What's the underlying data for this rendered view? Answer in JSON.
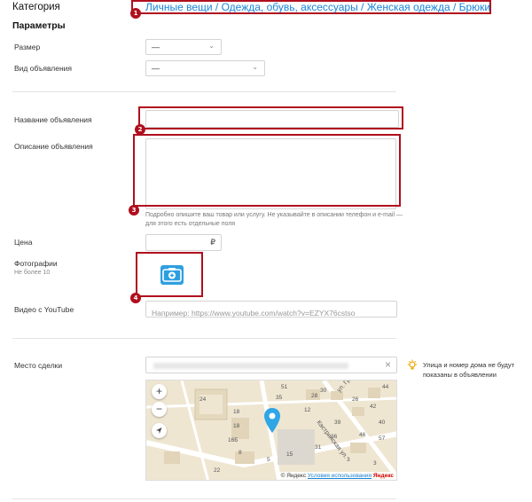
{
  "category": {
    "label": "Категория",
    "breadcrumb": "Личные вещи / Одежда, обувь, аксессуары / Женская одежда / Брюки"
  },
  "params": {
    "heading": "Параметры",
    "size_label": "Размер",
    "size_value": "—",
    "adtype_label": "Вид объявления",
    "adtype_value": "—"
  },
  "form": {
    "title_label": "Название объявления",
    "title_value": "",
    "description_label": "Описание объявления",
    "description_hint": "Подробно опишите ваш товар или услугу. Не указывайте в описании телефон и e-mail — для этого есть отдельные поля",
    "price_label": "Цена",
    "price_currency": "₽",
    "photos_label": "Фотографии",
    "photos_sub": "Не более 10",
    "youtube_label": "Видео с YouTube",
    "youtube_placeholder": "Например: https://www.youtube.com/watch?v=EZYX76cstso"
  },
  "location": {
    "label": "Место сделки",
    "clear_icon": "×",
    "tip": "Улица и номер дома не будут показаны в объявлении"
  },
  "map": {
    "zoom_in": "+",
    "zoom_out": "−",
    "house_numbers": [
      "24",
      "18",
      "18",
      "16Б",
      "51",
      "35",
      "30",
      "28",
      "26",
      "44",
      "42",
      "40",
      "12",
      "39",
      "46",
      "36",
      "31",
      "57",
      "15",
      "5",
      "3",
      "3",
      "8",
      "22"
    ],
    "street_1": "ул. Григорьева",
    "street_2": "Кастринская ул.",
    "copyright": "© Яндекс",
    "terms": "Условия использования",
    "brand": "Яндекс"
  },
  "annotations": [
    "1",
    "2",
    "3",
    "4"
  ],
  "colors": {
    "accent": "#1a84d8",
    "annotation": "#b00f1e",
    "photo_button": "#2d9fe0",
    "map_pin": "#2fa6e6"
  }
}
